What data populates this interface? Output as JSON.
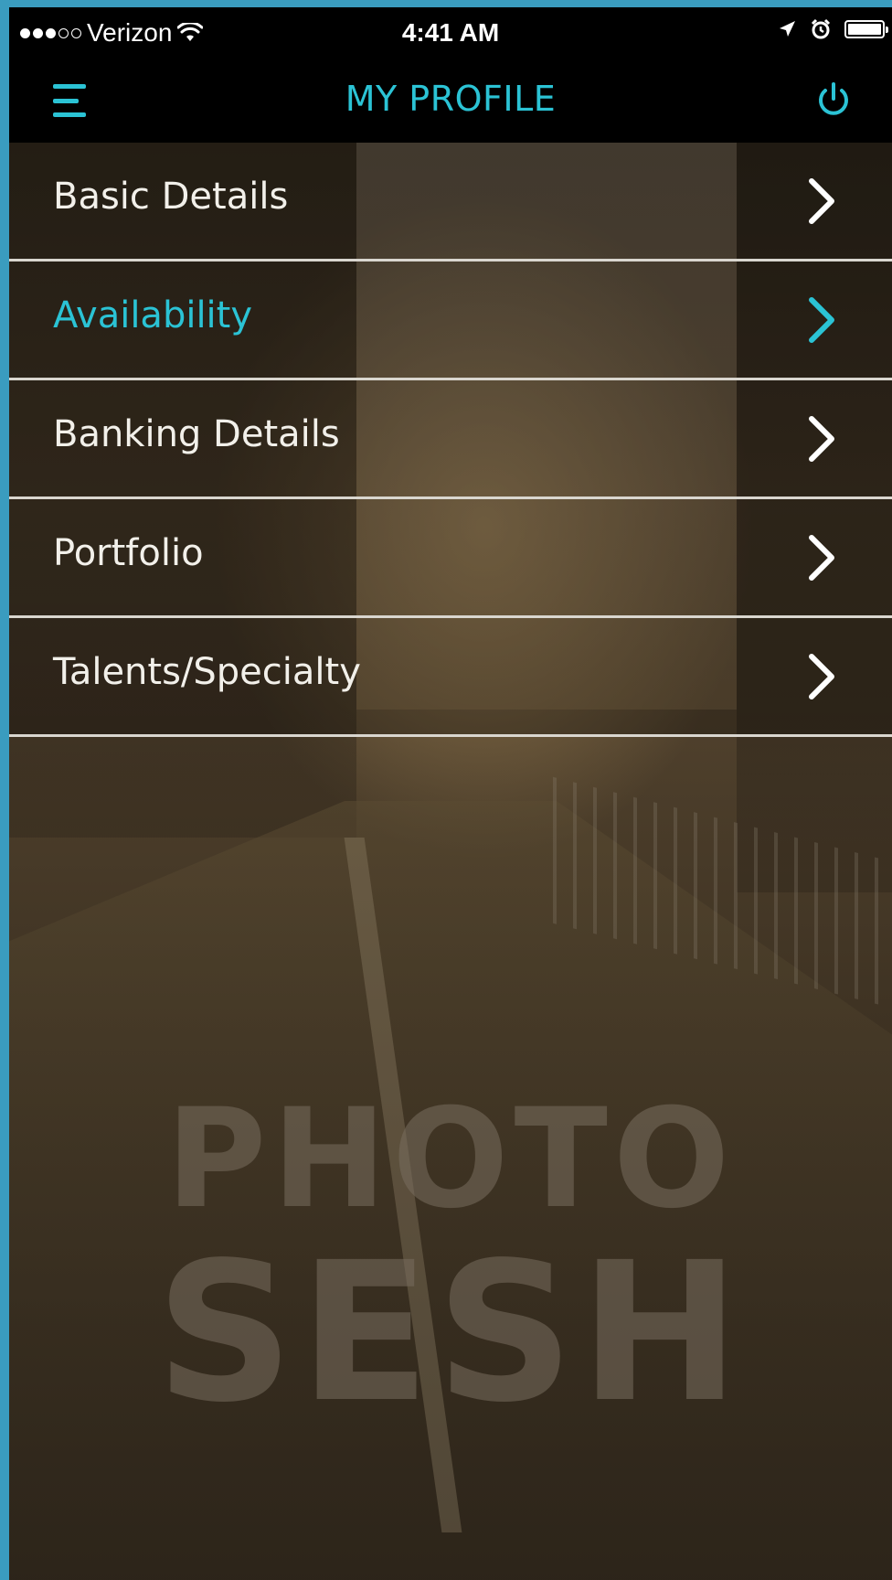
{
  "status_bar": {
    "carrier": "Verizon",
    "time": "4:41 AM",
    "signal_strength": 3,
    "signal_max": 5,
    "battery_level": 1.0
  },
  "nav": {
    "title": "MY PROFILE",
    "menu_icon": "hamburger-menu-icon",
    "power_icon": "power-icon"
  },
  "menu": {
    "items": [
      {
        "label": "Basic Details",
        "active": false
      },
      {
        "label": "Availability",
        "active": true
      },
      {
        "label": "Banking Details",
        "active": false
      },
      {
        "label": "Portfolio",
        "active": false
      },
      {
        "label": "Talents/Specialty",
        "active": false
      }
    ]
  },
  "watermark": {
    "line1": "PHOTO",
    "line2": "SESH"
  },
  "colors": {
    "accent": "#2bc3d5",
    "text": "#f2f0ea",
    "divider": "#d9d6cf",
    "bar_bg": "#000000"
  }
}
